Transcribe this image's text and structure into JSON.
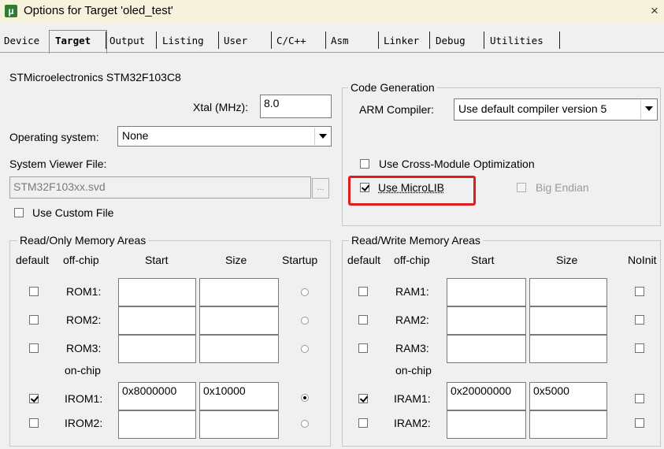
{
  "window": {
    "title": "Options for Target 'oled_test'",
    "close": "×"
  },
  "tabs": [
    "Device",
    "Target",
    "Output",
    "Listing",
    "User",
    "C/C++",
    "Asm",
    "Linker",
    "Debug",
    "Utilities"
  ],
  "device": {
    "name": "STMicroelectronics STM32F103C8"
  },
  "xtal": {
    "label": "Xtal (MHz):",
    "value": "8.0"
  },
  "os": {
    "label": "Operating system:",
    "value": "None"
  },
  "svf": {
    "label": "System Viewer File:",
    "value": "STM32F103xx.svd",
    "browse": "...",
    "custom_label": "Use Custom File"
  },
  "codegen": {
    "title": "Code Generation",
    "compiler_label": "ARM Compiler:",
    "compiler_value": "Use default compiler version 5",
    "cross_module": "Use Cross-Module Optimization",
    "microlib": "Use MicroLIB",
    "big_endian": "Big Endian"
  },
  "ro": {
    "title": "Read/Only Memory Areas",
    "headers": {
      "default": "default",
      "offchip": "off-chip",
      "start": "Start",
      "size": "Size",
      "startup": "Startup"
    },
    "onchip_label": "on-chip",
    "rows": [
      {
        "label": "ROM1:",
        "start": "",
        "size": "",
        "default": false,
        "startup": false
      },
      {
        "label": "ROM2:",
        "start": "",
        "size": "",
        "default": false,
        "startup": false
      },
      {
        "label": "ROM3:",
        "start": "",
        "size": "",
        "default": false,
        "startup": false
      },
      {
        "label": "IROM1:",
        "start": "0x8000000",
        "size": "0x10000",
        "default": true,
        "startup": true
      },
      {
        "label": "IROM2:",
        "start": "",
        "size": "",
        "default": false,
        "startup": false
      }
    ]
  },
  "rw": {
    "title": "Read/Write Memory Areas",
    "headers": {
      "default": "default",
      "offchip": "off-chip",
      "start": "Start",
      "size": "Size",
      "noinit": "NoInit"
    },
    "onchip_label": "on-chip",
    "rows": [
      {
        "label": "RAM1:",
        "start": "",
        "size": "",
        "default": false,
        "noinit": false
      },
      {
        "label": "RAM2:",
        "start": "",
        "size": "",
        "default": false,
        "noinit": false
      },
      {
        "label": "RAM3:",
        "start": "",
        "size": "",
        "default": false,
        "noinit": false
      },
      {
        "label": "IRAM1:",
        "start": "0x20000000",
        "size": "0x5000",
        "default": true,
        "noinit": false
      },
      {
        "label": "IRAM2:",
        "start": "",
        "size": "",
        "default": false,
        "noinit": false
      }
    ]
  }
}
